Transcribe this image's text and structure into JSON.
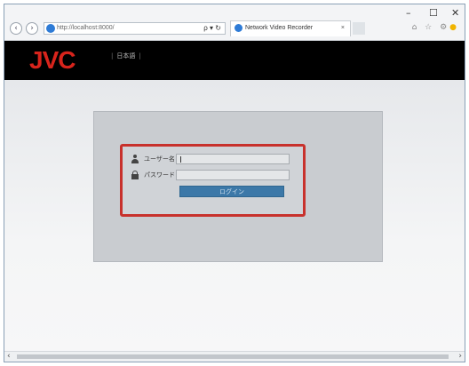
{
  "browser": {
    "address": "http://localhost:8000/",
    "address_tools": "ρ ▾ ↻",
    "tab_title": "Network Video Recorder",
    "tab_close": "×",
    "minimize": "–",
    "maximize": "☐",
    "close": "✕",
    "back": "‹",
    "forward": "›",
    "home_icons": "⌂ ☆ ⚙"
  },
  "app": {
    "logo": "JVC",
    "menu_item": "日本語"
  },
  "login": {
    "username_label": "ユーザー名",
    "username_value": "",
    "password_label": "パスワード",
    "password_value": "",
    "login_button": "ログイン"
  },
  "scroll": {
    "left": "‹",
    "right": "›"
  }
}
